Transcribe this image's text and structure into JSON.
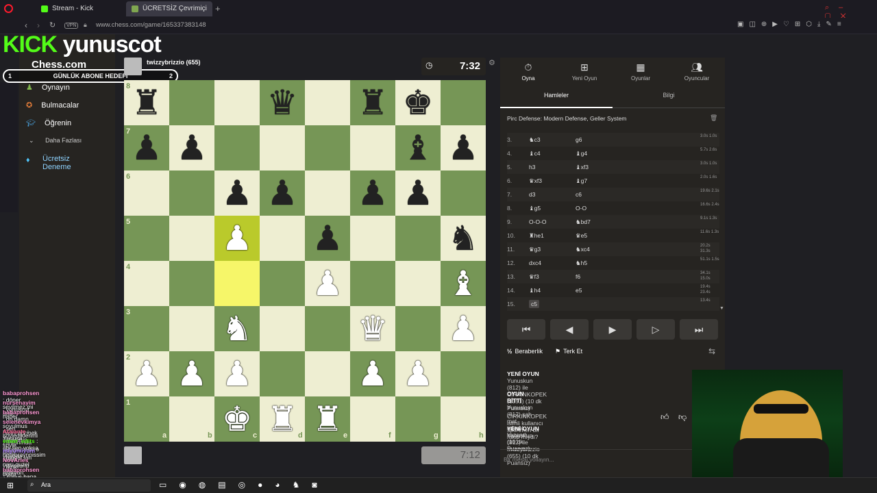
{
  "browser": {
    "tabs": [
      {
        "label": "Stream - Kick Dashboard",
        "color": "#53fc18"
      },
      {
        "label": "ÜCRETSİZ Çevrimiçi Satra",
        "color": "#7fa650"
      }
    ],
    "vpn": "VPN",
    "url": "www.chess.com/game/165337383148"
  },
  "overlay": {
    "brand": "KICK",
    "channel": "yunuscot",
    "goal_label": "GÜNLÜK ABONE HEDEFİ",
    "goal_left": "1",
    "goal_right": "2"
  },
  "nav": {
    "logo": "Chess.com",
    "items": [
      "Oynayın",
      "Bulmacalar",
      "Öğrenin",
      "Daha Fazlası",
      "Ücretsiz Deneme"
    ]
  },
  "game": {
    "opponent": "twizzybrizzio (655)",
    "opponent_clock": "7:32",
    "player_clock": "7:12",
    "ranks": [
      "8",
      "7",
      "6",
      "5",
      "4",
      "3",
      "2",
      "1"
    ],
    "files": [
      "a",
      "b",
      "c",
      "d",
      "e",
      "f",
      "g",
      "h"
    ]
  },
  "panel": {
    "tabs": [
      {
        "label": "Oyna",
        "icon": "stopwatch-icon"
      },
      {
        "label": "Yeni Oyun",
        "icon": "plus-icon"
      },
      {
        "label": "Oyunlar",
        "icon": "board-icon"
      },
      {
        "label": "Oyuncular",
        "icon": "players-icon"
      }
    ],
    "subtabs": [
      "Hamleler",
      "Bilgi"
    ],
    "opening": "Pirc Defense: Modern Defense, Geller System",
    "moves": [
      {
        "n": "3.",
        "w": "♞c3",
        "b": "g6",
        "t": "3.0s 1.0s"
      },
      {
        "n": "4.",
        "w": "♝c4",
        "b": "♝g4",
        "t": "5.7s 2.6s"
      },
      {
        "n": "5.",
        "w": "h3",
        "b": "♝xf3",
        "t": "3.0s 1.0s"
      },
      {
        "n": "6.",
        "w": "♛xf3",
        "b": "♝g7",
        "t": "2.0s 1.6s"
      },
      {
        "n": "7.",
        "w": "d3",
        "b": "c6",
        "t": "19.6s 2.1s"
      },
      {
        "n": "8.",
        "w": "♝g5",
        "b": "O-O",
        "t": "16.6s 2.4s"
      },
      {
        "n": "9.",
        "w": "O-O-O",
        "b": "♞bd7",
        "t": "9.1s 1.3s"
      },
      {
        "n": "10.",
        "w": "♜he1",
        "b": "♛e5",
        "t": "11.6s 1.3s"
      },
      {
        "n": "11.",
        "w": "♛g3",
        "b": "♞xc4",
        "t": "20.2s 31.3s"
      },
      {
        "n": "12.",
        "w": "dxc4",
        "b": "♞h5",
        "t": "51.1s 1.5s"
      },
      {
        "n": "13.",
        "w": "♛f3",
        "b": "f6",
        "t": "34.1s 15.0s"
      },
      {
        "n": "14.",
        "w": "♝h4",
        "b": "e5",
        "t": "19.4s 23.4s"
      },
      {
        "n": "15.",
        "w": "c5",
        "b": "",
        "t": "13.4s"
      }
    ],
    "draw": "Beraberlik",
    "resign": "Terk Et",
    "feed": [
      {
        "title": "YENİ OYUN",
        "text": "Yunuskun (812) ile CIRKINKOPEK (1351) (10 dk Puansız)"
      },
      {
        "title": "OYUN BİTTİ",
        "text": "Yunuskun (812) şah mat ederek kazandı (10 dk Puansız)"
      },
      {
        "title": "",
        "text": "CIRKINKOPEK isimli kullanıcı sportmen bir rakip miydi?"
      },
      {
        "title": "YENİ OYUN",
        "text": "Yunuskun (812) ile twizzybrizzio (655) (10 dk Puansız)"
      }
    ],
    "chat_placeholder": "Bir mesaj yollayın..."
  },
  "chat": [
    {
      "user": "babaprohsen",
      "msg": ": döner sevilmez mi amk",
      "color": "#ff9ad5"
    },
    {
      "user": "nursenayim",
      "msg": ": yunuscot naber",
      "color": "#ff9ad5"
    },
    {
      "user": "babaprohsen",
      "msg": ": oh damn soyulmus halini görmek istermisin",
      "color": "#ff9ad5"
    },
    {
      "user": "selenevkimya",
      "msg": ": sen söylediklerimi zamanında yapmıyosun o yüzden",
      "color": "#ff9ad5"
    },
    {
      "user": "Atalante",
      "msg": ": Yunusa soyle atsın Sana vidyosunu ozaman",
      "color": "#ff6b9a"
    },
    {
      "user": "emwr_edits",
      "msg": ": abi sen yoksa hebroraynnissim",
      "color": "#53fc18"
    },
    {
      "user": "miyumiyum",
      "msg": ": mogat lan nası guzel biss ankaragaa",
      "color": "#b388ff"
    },
    {
      "user": "NovAries",
      "msg": ": amk delisi",
      "color": "#ff9ad5"
    },
    {
      "user": "babaprohsen",
      "msg": ": Yonus bana at.",
      "color": "#ff9ad5"
    }
  ],
  "taskbar": {
    "search": "Ara"
  }
}
